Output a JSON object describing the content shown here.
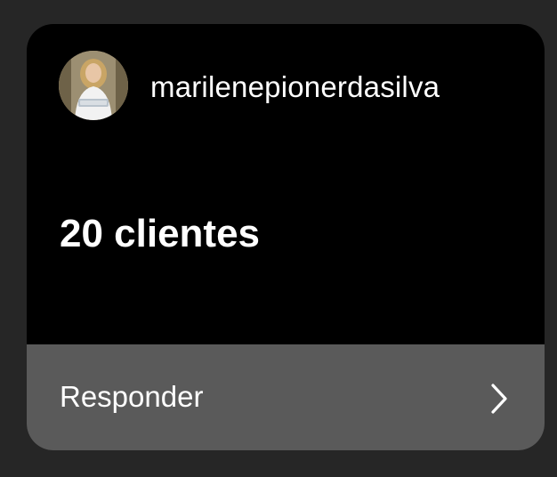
{
  "story_reply": {
    "username": "marilenepionerdasilva",
    "message": "20 clientes",
    "reply_label": "Responder",
    "avatar_icon": "profile-photo",
    "chevron_icon": "chevron-right-icon"
  },
  "colors": {
    "page_background": "#262626",
    "card_background": "#000000",
    "reply_bar_background": "#5a5a5a",
    "text": "#ffffff"
  }
}
